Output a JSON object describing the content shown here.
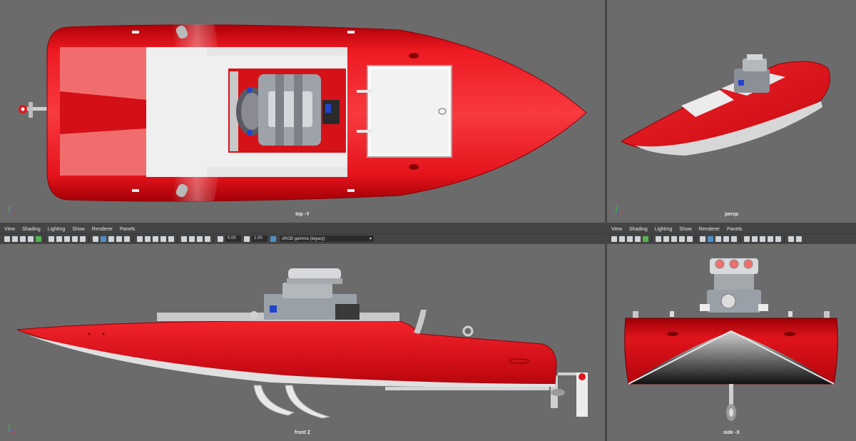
{
  "viewports": {
    "top": {
      "camera_label": "top -Y"
    },
    "persp": {
      "camera_label": "persp"
    },
    "front": {
      "camera_label": "front Z"
    },
    "side": {
      "camera_label": "side -X"
    }
  },
  "panel_menu_front": [
    {
      "label": "View"
    },
    {
      "label": "Shading"
    },
    {
      "label": "Lighting"
    },
    {
      "label": "Show"
    },
    {
      "label": "Renderer"
    },
    {
      "label": "Panels"
    }
  ],
  "panel_menu_side": [
    {
      "label": "View"
    },
    {
      "label": "Shading"
    },
    {
      "label": "Lighting"
    },
    {
      "label": "Show"
    },
    {
      "label": "Renderer"
    },
    {
      "label": "Panels"
    }
  ],
  "toolbar": {
    "exposure_value": "0.00",
    "gamma_value": "1.00",
    "color_space": "sRGB gamma (legacy)"
  },
  "colors": {
    "viewport_bg": "#6b6b6b",
    "hull_red": "#e0141c",
    "deck_white": "#efefef",
    "ui_dark": "#444444"
  }
}
